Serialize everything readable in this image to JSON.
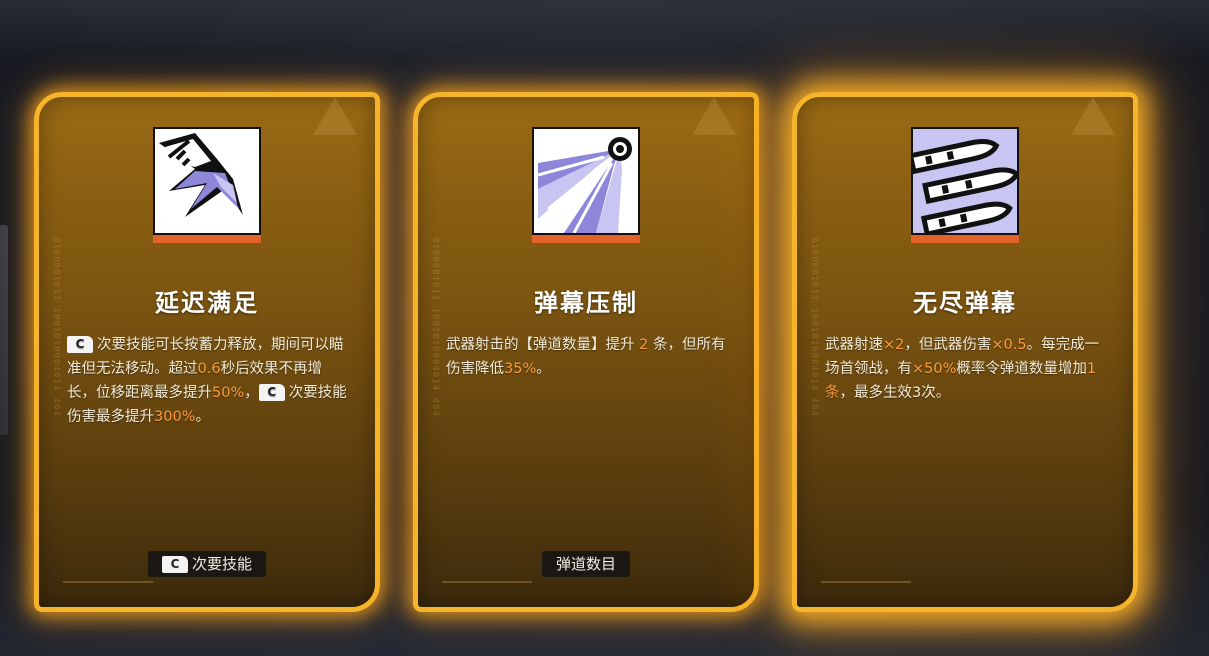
{
  "cards": [
    {
      "title": "延迟满足",
      "icon": "dash-slash-icon",
      "desc_segments": [
        {
          "type": "key",
          "text": "C"
        },
        {
          "type": "text",
          "text": "次要技能可长按蓄力释放，期间可以瞄准但无法移动。超过"
        },
        {
          "type": "hl",
          "text": "0.6"
        },
        {
          "type": "text",
          "text": "秒后效果不再增长，位移距离最多提升"
        },
        {
          "type": "hl",
          "text": "50%"
        },
        {
          "type": "text",
          "text": "，"
        },
        {
          "type": "key",
          "text": "C"
        },
        {
          "type": "text",
          "text": "次要技能伤害最多提升"
        },
        {
          "type": "hl",
          "text": "300%"
        },
        {
          "type": "text",
          "text": "。"
        }
      ],
      "tag": {
        "key": "C",
        "label": "次要技能"
      }
    },
    {
      "title": "弹幕压制",
      "icon": "barrage-burst-icon",
      "desc_segments": [
        {
          "type": "text",
          "text": "武器射击的【弹道数量】提升 "
        },
        {
          "type": "hl",
          "text": "2"
        },
        {
          "type": "text",
          "text": " 条，但所有伤害降低"
        },
        {
          "type": "hl",
          "text": "35%"
        },
        {
          "type": "text",
          "text": "。"
        }
      ],
      "tag": {
        "key": "",
        "label": "弹道数目"
      }
    },
    {
      "title": "无尽弹幕",
      "icon": "bullets-icon",
      "desc_segments": [
        {
          "type": "text",
          "text": "武器射速"
        },
        {
          "type": "hl",
          "text": "×2"
        },
        {
          "type": "text",
          "text": "，但武器伤害"
        },
        {
          "type": "hl",
          "text": "×0.5"
        },
        {
          "type": "text",
          "text": "。每完成一场首领战，有"
        },
        {
          "type": "hl",
          "text": "×50%"
        },
        {
          "type": "text",
          "text": "概率令弹道数量增加"
        },
        {
          "type": "hl",
          "text": "1条"
        },
        {
          "type": "text",
          "text": "，最多生效3次。"
        }
      ],
      "tag": null
    }
  ],
  "colors": {
    "card_border": "#f5b42a",
    "highlight": "#ff9c3a",
    "icon_bar": "#e2622a",
    "icon_purple": "#8d86d9"
  }
}
